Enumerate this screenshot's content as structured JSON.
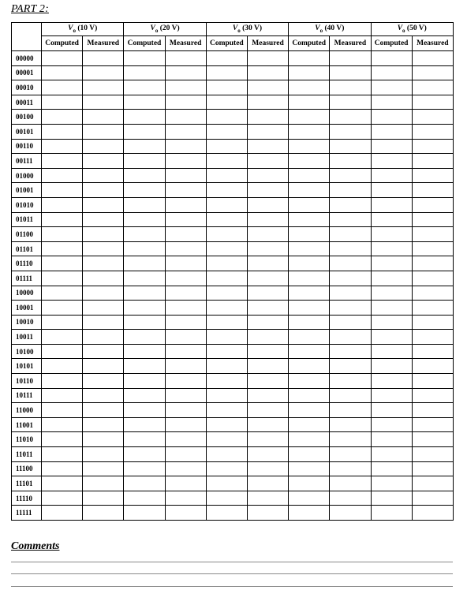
{
  "part_title": "PART 2:",
  "table": {
    "corner": "",
    "groups": [
      {
        "symbol": "V",
        "subscript": "o",
        "label": " (10 V)"
      },
      {
        "symbol": "V",
        "subscript": "o",
        "label": " (20 V)"
      },
      {
        "symbol": "V",
        "subscript": "o",
        "label": " (30 V)"
      },
      {
        "symbol": "V",
        "subscript": "o",
        "label": " (40 V)"
      },
      {
        "symbol": "V",
        "subscript": "o",
        "label": " (50 V)"
      }
    ],
    "subheaders": [
      "Computed",
      "Measured"
    ],
    "rows": [
      "00000",
      "00001",
      "00010",
      "00011",
      "00100",
      "00101",
      "00110",
      "00111",
      "01000",
      "01001",
      "01010",
      "01011",
      "01100",
      "01101",
      "01110",
      "01111",
      "10000",
      "10001",
      "10010",
      "10011",
      "10100",
      "10101",
      "10110",
      "10111",
      "11000",
      "11001",
      "11010",
      "11011",
      "11100",
      "11101",
      "11110",
      "11111"
    ]
  },
  "comments": {
    "title": "Comments",
    "line_count": 3
  }
}
